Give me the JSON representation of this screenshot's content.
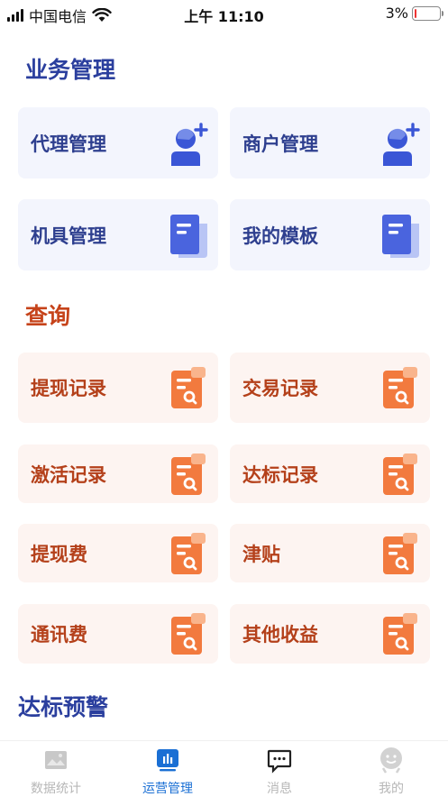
{
  "status_bar": {
    "carrier": "中国电信",
    "time": "上午 11:10",
    "battery": "3%"
  },
  "sections": {
    "business": {
      "title": "业务管理",
      "items": [
        "代理管理",
        "商户管理",
        "机具管理",
        "我的模板"
      ]
    },
    "query": {
      "title": "查询",
      "items": [
        "提现记录",
        "交易记录",
        "激活记录",
        "达标记录",
        "提现费",
        "津贴",
        "通讯费",
        "其他收益"
      ]
    },
    "alert": {
      "title": "达标预警"
    }
  },
  "tabbar": {
    "tabs": [
      {
        "label": "数据统计",
        "icon": "image-chart-icon"
      },
      {
        "label": "运营管理",
        "icon": "bar-chart-icon"
      },
      {
        "label": "消息",
        "icon": "message-icon"
      },
      {
        "label": "我的",
        "icon": "user-avatar-icon"
      }
    ]
  },
  "colors": {
    "blue_title": "#2b3f9e",
    "orange_title": "#c6431a",
    "active_tab": "#1a6fd4"
  }
}
